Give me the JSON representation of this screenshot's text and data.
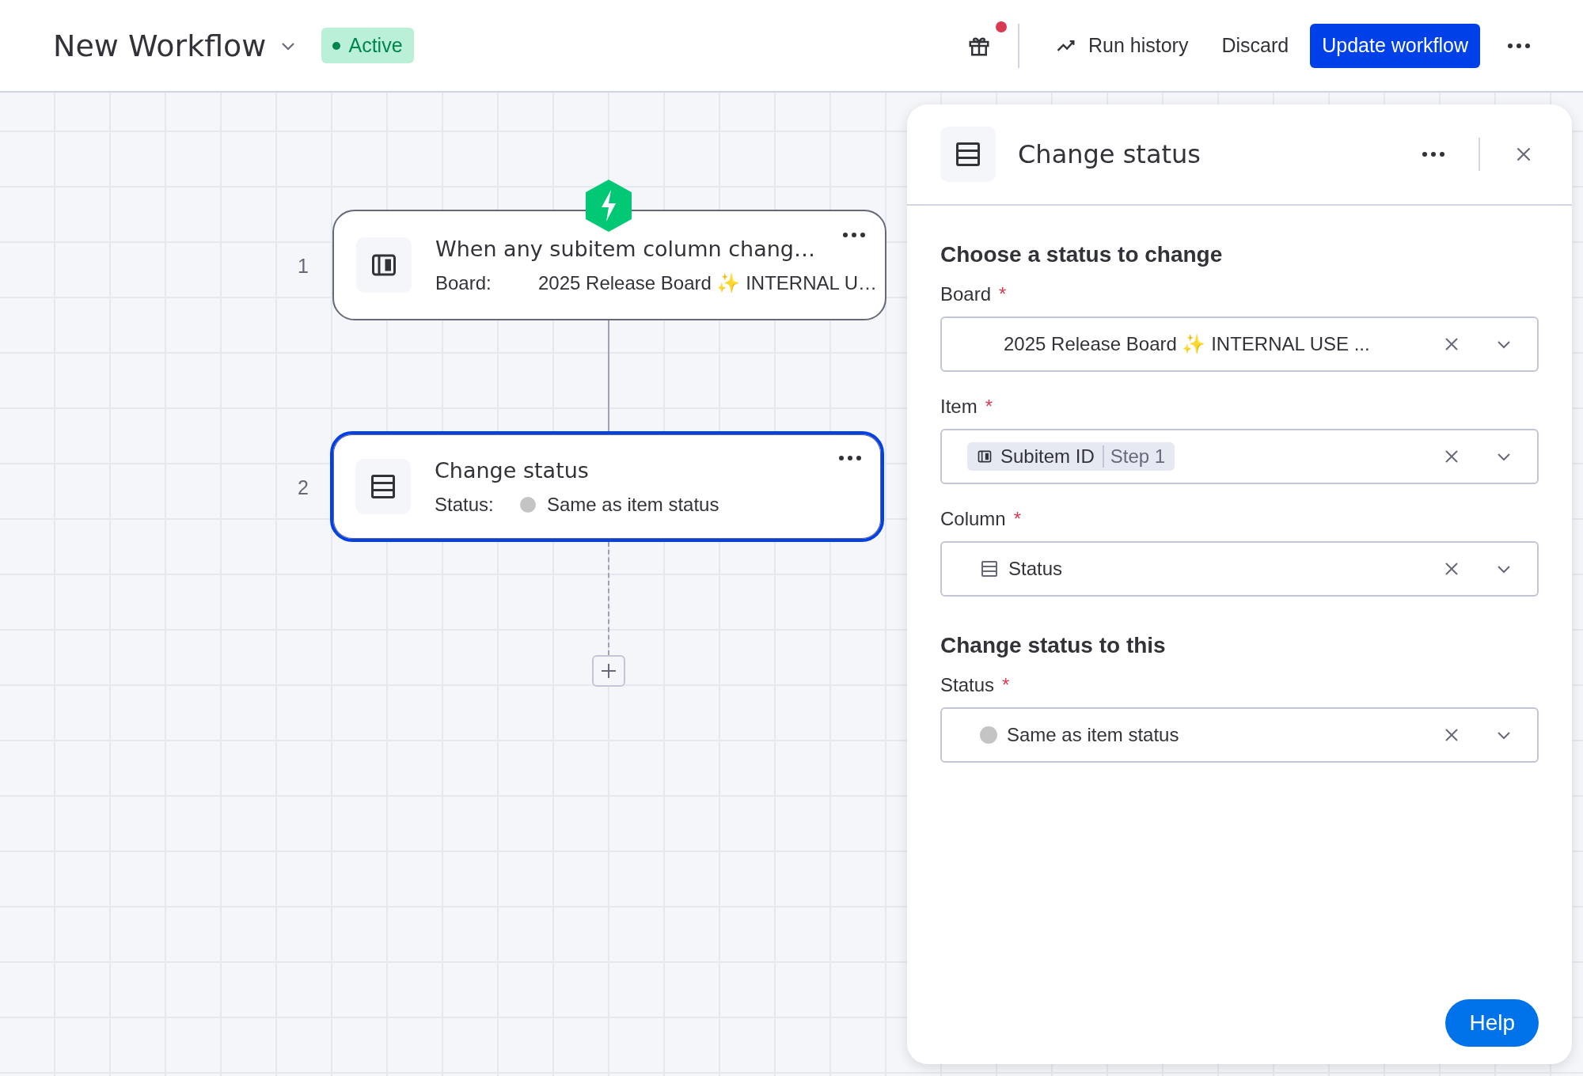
{
  "header": {
    "title": "New Workflow",
    "status_badge": {
      "label": "Active"
    },
    "has_notification": true,
    "buttons": [
      {
        "kind": "history",
        "label": "Run history"
      },
      {
        "kind": "plain",
        "label": "Discard"
      },
      {
        "kind": "primary",
        "label": "Update workflow"
      }
    ]
  },
  "canvas": {
    "nodes": [
      {
        "number": "1",
        "kind": "trigger",
        "title": "When any subitem column chang…",
        "field_label": "Board:",
        "field_value": "2025 Release Board ✨ INTERNAL U…",
        "selected": false
      },
      {
        "number": "2",
        "kind": "action",
        "title": "Change status",
        "field_label": "Status:",
        "field_value": "Same as item status",
        "selected": true
      }
    ]
  },
  "panel": {
    "title": "Change status",
    "sections": [
      {
        "heading": "Choose a status to change",
        "fields": [
          {
            "label": "Board",
            "required_mark": "*",
            "kind": "text",
            "value": "2025 Release Board ✨ INTERNAL USE ..."
          },
          {
            "label": "Item",
            "required_mark": "*",
            "kind": "chip",
            "value": "Subitem ID",
            "sub": "Step 1"
          },
          {
            "label": "Column",
            "required_mark": "*",
            "kind": "column",
            "value": "Status"
          }
        ]
      },
      {
        "heading": "Change status to this",
        "fields": [
          {
            "label": "Status",
            "required_mark": "*",
            "kind": "status",
            "value": "Same as item status"
          }
        ]
      }
    ]
  },
  "help": {
    "label": "Help"
  }
}
